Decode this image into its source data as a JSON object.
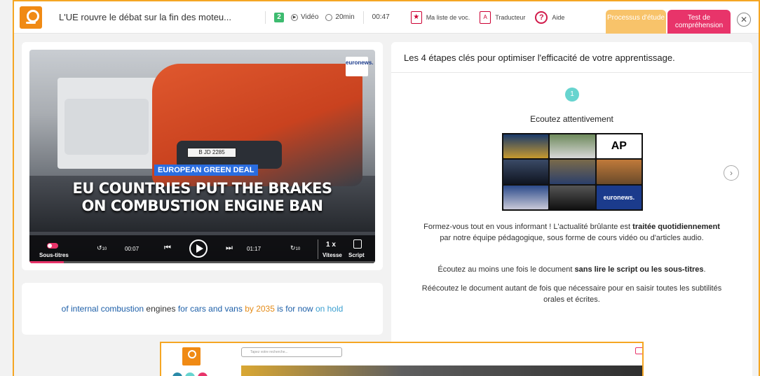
{
  "header": {
    "title": "L'UE rouvre le débat sur la fin des moteu...",
    "level": "2",
    "media_type": "Vidéo",
    "duration": "20min",
    "time": "00:47",
    "vocab_label": "Ma liste de voc.",
    "translator_label": "Traducteur",
    "help_label": "Aide",
    "tab_process": "Processus d'étude",
    "tab_test": "Test de compréhension"
  },
  "video": {
    "channel": "euronews.",
    "plate": "B JD 2285",
    "tag": "EUROPEAN GREEN DEAL",
    "headline_line1": "EU COUNTRIES PUT THE BRAKES",
    "headline_line2": "ON COMBUSTION ENGINE BAN",
    "subtitles_label": "Sous-titres",
    "rewind": "10",
    "forward": "10",
    "current_time": "00:07",
    "total_time": "01:17",
    "speed_value": "1 x",
    "speed_label": "Vitesse",
    "script_label": "Script",
    "progress": 0.1
  },
  "subtitle": {
    "w1": "of internal",
    "w2": "combustion",
    "w3": "engines",
    "w4": "for cars and vans",
    "w5": "by 2035",
    "w6": "is for now",
    "w7": "on hold"
  },
  "panel": {
    "title": "Les 4 étapes clés pour optimiser l'efficacité de votre apprentissage.",
    "step_number": "1",
    "step_title": "Ecoutez attentivement",
    "collage_ap": "AP",
    "collage_euronews": "euronews.",
    "p1_a": "Formez-vous tout en vous informant ! L'actualité brûlante est ",
    "p1_b": "traitée quotidiennement",
    "p1_c": " par notre équipe pédagogique, sous forme de cours vidéo ou d'articles audio.",
    "p2_a": "Écoutez au moins une fois le document ",
    "p2_b": "sans lire le script ou les sous-titres",
    "p2_c": ".",
    "p3": "Réécoutez le document autant de fois que nécessaire pour en saisir toutes les subtilités orales et écrites."
  },
  "inset": {
    "search_placeholder": "Tapez votre recherche..."
  },
  "colors": {
    "accent_orange": "#f5a623",
    "accent_pink": "#e8346a",
    "step_teal": "#67d4cf",
    "subtitle_blue": "#1d5fa8",
    "subtitle_orange": "#e48b17",
    "subtitle_teal": "#3a9fd0"
  }
}
